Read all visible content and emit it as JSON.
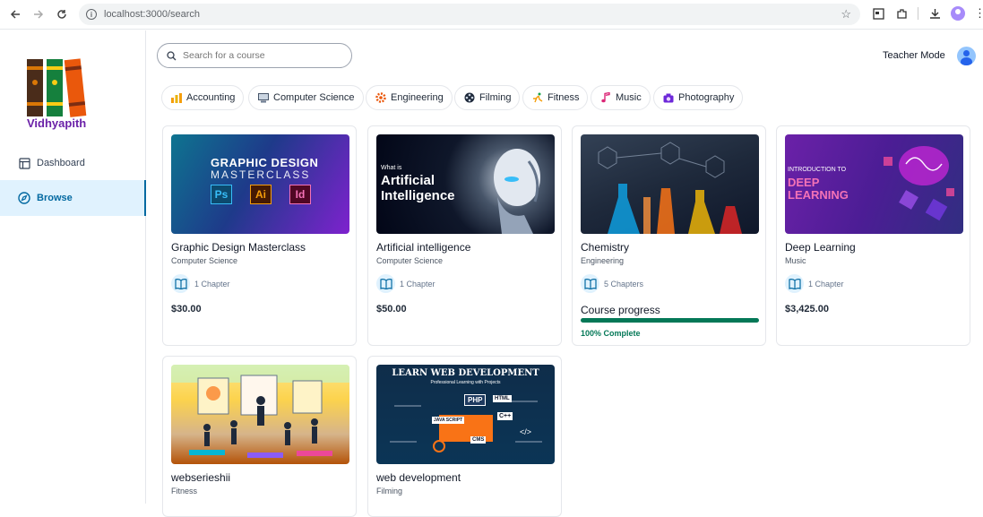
{
  "browser": {
    "url": "localhost:3000/search",
    "back_icon": "arrow-left-icon",
    "forward_icon": "arrow-right-icon",
    "reload_icon": "reload-icon"
  },
  "sidebar": {
    "brand": "Vidhyapith",
    "items": [
      {
        "label": "Dashboard",
        "icon": "layout-icon",
        "active": false
      },
      {
        "label": "Browse",
        "icon": "compass-icon",
        "active": true
      }
    ]
  },
  "header": {
    "search_placeholder": "Search for a course",
    "teacher_mode": "Teacher Mode"
  },
  "categories": [
    {
      "label": "Accounting",
      "icon": "bar-chart-icon"
    },
    {
      "label": "Computer Science",
      "icon": "computer-icon"
    },
    {
      "label": "Engineering",
      "icon": "gear-icon"
    },
    {
      "label": "Filming",
      "icon": "film-reel-icon"
    },
    {
      "label": "Fitness",
      "icon": "running-icon"
    },
    {
      "label": "Music",
      "icon": "music-note-icon"
    },
    {
      "label": "Photography",
      "icon": "camera-icon"
    }
  ],
  "courses": [
    {
      "title": "Graphic Design Masterclass",
      "category": "Computer Science",
      "chapters": "1 Chapter",
      "price": "$30.00",
      "thumb": {
        "line1": "GRAPHIC DESIGN",
        "line2": "MASTERCLASS",
        "apps": [
          "Ps",
          "Ai",
          "Id"
        ]
      }
    },
    {
      "title": "Artificial intelligence",
      "category": "Computer Science",
      "chapters": "1 Chapter",
      "price": "$50.00",
      "thumb": {
        "small": "What is",
        "line1": "Artificial",
        "line2": "Intelligence"
      }
    },
    {
      "title": "Chemistry",
      "category": "Engineering",
      "chapters": "5 Chapters",
      "progress": {
        "label": "Course progress",
        "value": 100,
        "text": "100% Complete"
      }
    },
    {
      "title": "Deep Learning",
      "category": "Music",
      "chapters": "1 Chapter",
      "price": "$3,425.00",
      "thumb": {
        "small": "INTRODUCTION TO",
        "line1": "DEEP",
        "line2": "LEARNING"
      }
    },
    {
      "title": "webserieshii",
      "category": "Fitness"
    },
    {
      "title": "web development",
      "category": "Filming",
      "thumb": {
        "line1": "LEARN WEB DEVELOPMENT",
        "line2": "Professional Learning with Projects",
        "tags": [
          "PHP",
          "HTML",
          "C++",
          "CMS",
          "JAVA SCRIPT",
          "</>"
        ]
      }
    }
  ],
  "colors": {
    "brand": "#6b21a8",
    "active_nav": "#0369a1",
    "progress": "#047857"
  }
}
